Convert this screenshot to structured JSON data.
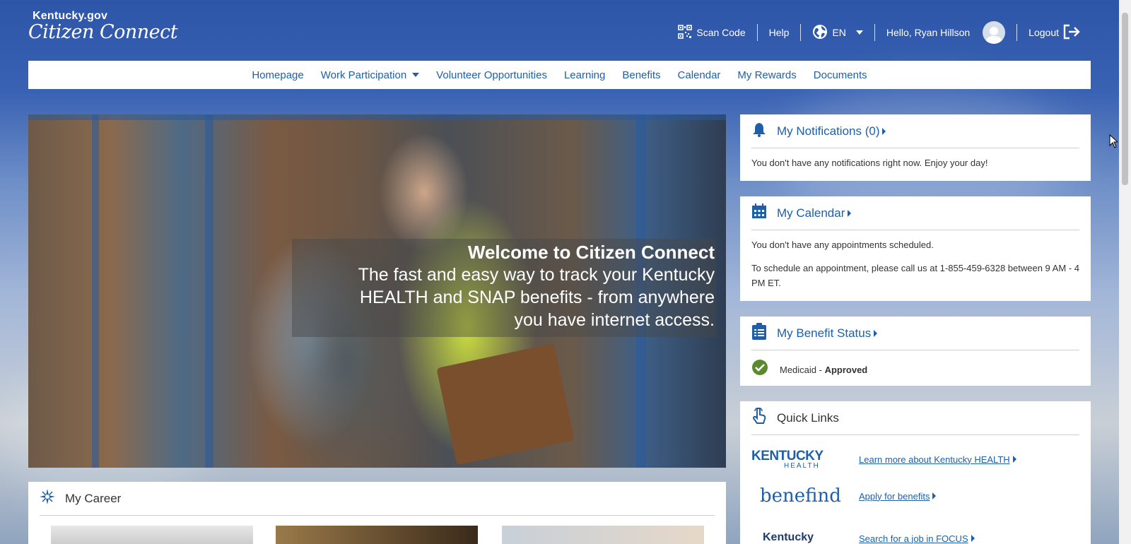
{
  "brand": {
    "top": "Kentucky.gov",
    "script": "Citizen Connect"
  },
  "topbar": {
    "scan": "Scan Code",
    "help": "Help",
    "lang": "EN",
    "greeting": "Hello, Ryan Hillson",
    "logout": "Logout"
  },
  "nav": {
    "items": [
      "Homepage",
      "Work Participation",
      "Volunteer Opportunities",
      "Learning",
      "Benefits",
      "Calendar",
      "My Rewards",
      "Documents"
    ]
  },
  "hero": {
    "title": "Welcome to Citizen Connect",
    "line1": "The fast and easy way to track your Kentucky",
    "line2": "HEALTH and SNAP benefits - from anywhere",
    "line3": "you have internet access."
  },
  "notifications": {
    "title": "My Notifications (0)",
    "text": "You don't have any notifications right now. Enjoy your day!"
  },
  "calendar": {
    "title": "My Calendar",
    "text1": "You don't have any appointments scheduled.",
    "text2": "To schedule an appointment, please call us at 1-855-459-6328 between 9 AM - 4 PM ET."
  },
  "benefit_status": {
    "title": "My Benefit Status",
    "program": "Medicaid - ",
    "status": "Approved"
  },
  "quick_links": {
    "title": "Quick Links",
    "items": [
      {
        "logo": "KENTUCKY",
        "logo_sub": "HEALTH",
        "link": "Learn more about Kentucky HEALTH"
      },
      {
        "logo": "benefind",
        "logo_sub": "",
        "link": "Apply for benefits"
      },
      {
        "logo": "Kentucky",
        "logo_sub": "",
        "link": "Search for a job in FOCUS"
      }
    ]
  },
  "career": {
    "title": "My Career"
  },
  "colors": {
    "link": "#1f5fa8",
    "header_bg": "#2d55a8",
    "approved": "#5a8a2e"
  }
}
